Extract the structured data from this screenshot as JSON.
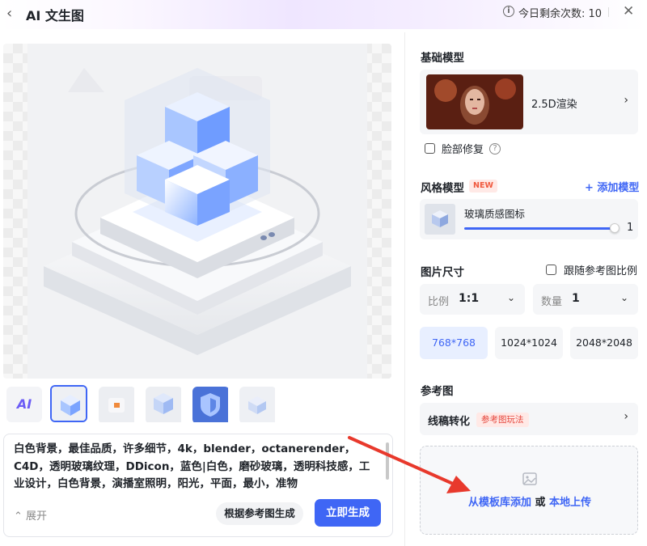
{
  "header": {
    "back_icon": "chevron-left-icon",
    "title": "AI 文生图",
    "quota_text": "今日剩余次数: 10",
    "info_icon": "info-icon",
    "close_icon": "close-icon"
  },
  "preview": {
    "image": "glass-cube-3d-render",
    "alt": ""
  },
  "thumbnails": [
    "logo-app",
    "glass-cube",
    "orange-box",
    "glass-box",
    "blue-shield",
    "glass-cube-2"
  ],
  "prompt": {
    "text": "白色背景，最佳品质，许多细节，4k，blender，octanerender，C4D，透明玻璃纹理，DDicon，蓝色|白色，磨砂玻璃，透明科技感，工业设计，白色背景，演播室照明，阳光，平面，最小，准物",
    "expand_label": "展开",
    "ref_generate_label": "根据参考图生成",
    "generate_label": "立即生成"
  },
  "base_model": {
    "label": "基础模型",
    "model_name": "2.5D渲染",
    "face_fix_label": "脸部修复",
    "help_icon": "question-icon"
  },
  "style_model": {
    "label": "风格模型",
    "badge": "NEW",
    "add_label": "+ 添加模型",
    "item_name": "玻璃质感图标",
    "weight": "1",
    "weight_fraction": 1.0
  },
  "image_size": {
    "label": "图片尺寸",
    "follow_ref_label": "跟随参考图比例",
    "ratio_key": "比例",
    "ratio_value": "1:1",
    "count_key": "数量",
    "count_value": "1",
    "sizes": [
      "768*768",
      "1024*1024",
      "2048*2048"
    ],
    "selected_size": "768*768"
  },
  "reference": {
    "label": "参考图",
    "mode_label": "线稿转化",
    "mode_tag": "参考图玩法",
    "upload_from_template": "从模板库添加",
    "upload_or": "或",
    "upload_local": "本地上传"
  },
  "colors": {
    "accent": "#3f66f5",
    "badge_red": "#f0593e"
  }
}
